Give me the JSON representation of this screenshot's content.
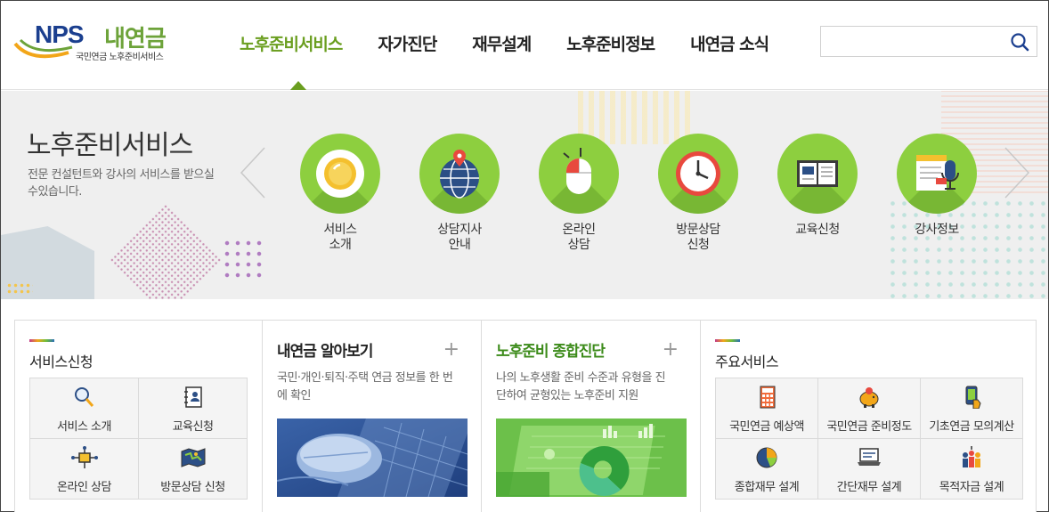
{
  "header": {
    "logo_brand": "NPS",
    "logo_name": "내연금",
    "logo_tagline": "국민연금 노후준비서비스",
    "nav": [
      "노후준비서비스",
      "자가진단",
      "재무설계",
      "노후준비정보",
      "내연금 소식"
    ],
    "active_nav": "노후준비서비스",
    "search_placeholder": ""
  },
  "banner": {
    "title": "노후준비서비스",
    "description": "전문 컨설턴트와 강사의 서비스를 받으실 수있습니다.",
    "services": [
      {
        "label": "서비스\n소개",
        "icon": "clock-plate-icon"
      },
      {
        "label": "상담지사\n안내",
        "icon": "globe-pin-icon"
      },
      {
        "label": "온라인\n상담",
        "icon": "mouse-icon"
      },
      {
        "label": "방문상담\n신청",
        "icon": "clock-icon"
      },
      {
        "label": "교육신청",
        "icon": "book-icon"
      },
      {
        "label": "강사정보",
        "icon": "microphone-document-icon"
      }
    ]
  },
  "panels": {
    "service_apply": {
      "title": "서비스신청",
      "items": [
        {
          "label": "서비스 소개",
          "icon": "magnifier-icon"
        },
        {
          "label": "교육신청",
          "icon": "address-book-icon"
        },
        {
          "label": "온라인 상담",
          "icon": "network-icon"
        },
        {
          "label": "방문상담 신청",
          "icon": "map-icon"
        }
      ]
    },
    "my_pension": {
      "title": "내연금 알아보기",
      "description": "국민·개인·퇴직·주택 연금 정보를 한 번에 확인",
      "more": "+"
    },
    "diagnosis": {
      "title": "노후준비 종합진단",
      "description": "나의 노후생활 준비 수준과 유형을 진단하여 균형있는 노후준비 지원",
      "more": "+"
    },
    "main_services": {
      "title": "주요서비스",
      "items": [
        {
          "label": "국민연금 예상액",
          "icon": "calculator-icon"
        },
        {
          "label": "국민연금 준비정도",
          "icon": "piggy-bank-icon"
        },
        {
          "label": "기초연금 모의계산",
          "icon": "phone-hand-icon"
        },
        {
          "label": "종합재무 설계",
          "icon": "pie-chart-icon"
        },
        {
          "label": "간단재무 설계",
          "icon": "laptop-icon"
        },
        {
          "label": "목적자금 설계",
          "icon": "target-people-icon"
        }
      ]
    }
  },
  "colors": {
    "brand_blue": "#1b3f8f",
    "brand_green": "#6a9e1f",
    "circle_green": "#8dcf3f",
    "panel_green_title": "#3c8b1a"
  }
}
